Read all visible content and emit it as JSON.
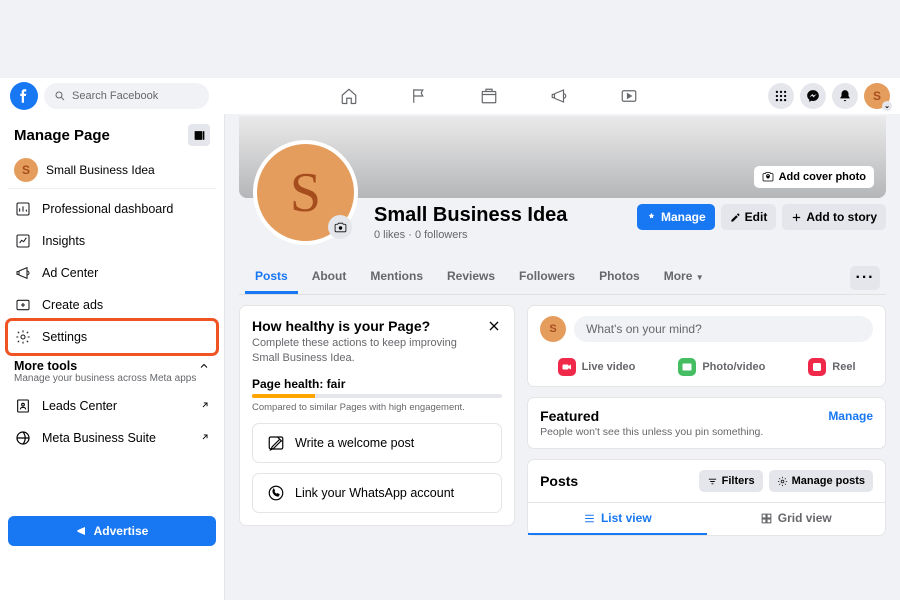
{
  "topbar": {
    "search_placeholder": "Search Facebook"
  },
  "sidebar": {
    "title": "Manage Page",
    "page_name": "Small Business Idea",
    "avatar_letter": "S",
    "items": [
      {
        "label": "Professional dashboard"
      },
      {
        "label": "Insights"
      },
      {
        "label": "Ad Center"
      },
      {
        "label": "Create ads"
      },
      {
        "label": "Settings"
      }
    ],
    "more": {
      "title": "More tools",
      "sub": "Manage your business across Meta apps"
    },
    "links": [
      {
        "label": "Leads Center"
      },
      {
        "label": "Meta Business Suite"
      }
    ],
    "advertise": "Advertise"
  },
  "page": {
    "name": "Small Business Idea",
    "stats": "0 likes · 0 followers",
    "avatar_letter": "S",
    "cover_btn": "Add cover photo",
    "buttons": {
      "manage": "Manage",
      "edit": "Edit",
      "add_story": "Add to story"
    }
  },
  "tabs": [
    "Posts",
    "About",
    "Mentions",
    "Reviews",
    "Followers",
    "Photos",
    "More"
  ],
  "dots": "···",
  "health": {
    "title": "How healthy is your Page?",
    "sub_prefix": "Complete these actions to keep improving ",
    "label": "Page health: fair",
    "compare": "Compared to similar Pages with high engagement.",
    "actions": [
      {
        "label": "Write a welcome post"
      },
      {
        "label": "Link your WhatsApp account"
      }
    ]
  },
  "composer": {
    "placeholder": "What's on your mind?",
    "opts": [
      {
        "label": "Live video",
        "color": "#f02849"
      },
      {
        "label": "Photo/video",
        "color": "#45bd62"
      },
      {
        "label": "Reel",
        "color": "#f02849"
      }
    ]
  },
  "featured": {
    "title": "Featured",
    "manage": "Manage",
    "info": "People won't see this unless you pin something."
  },
  "posts": {
    "title": "Posts",
    "filters": "Filters",
    "manage_posts": "Manage posts",
    "list_view": "List view",
    "grid_view": "Grid view"
  }
}
